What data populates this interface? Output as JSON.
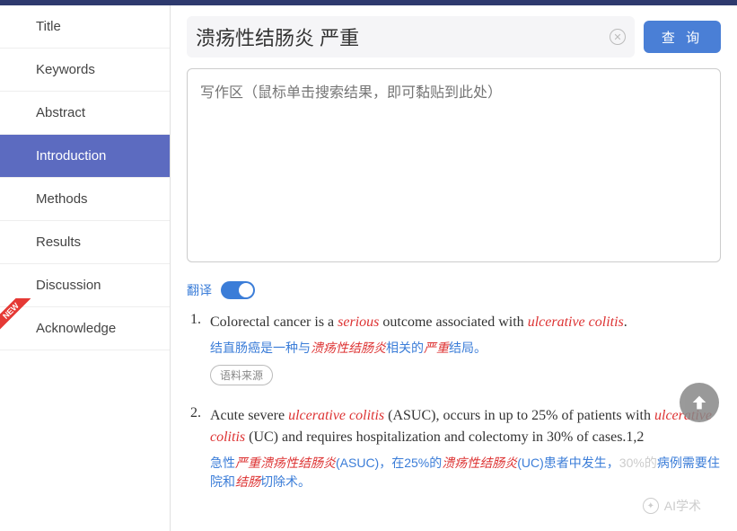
{
  "sidebar": {
    "items": [
      {
        "label": "Title"
      },
      {
        "label": "Keywords"
      },
      {
        "label": "Abstract"
      },
      {
        "label": "Introduction",
        "active": true
      },
      {
        "label": "Methods"
      },
      {
        "label": "Results"
      },
      {
        "label": "Discussion"
      },
      {
        "label": "Acknowledge",
        "new": true
      }
    ],
    "new_badge": "NEW"
  },
  "search": {
    "value": "溃疡性结肠炎 严重",
    "clear_glyph": "✕",
    "query_label": "查 询"
  },
  "writing_area": {
    "placeholder": "写作区（鼠标单击搜索结果，即可黏贴到此处）"
  },
  "translate": {
    "label": "翻译",
    "on": true
  },
  "results": [
    {
      "num": "1.",
      "en_parts": [
        {
          "t": "Colorectal cancer is a ",
          "hl": false
        },
        {
          "t": "serious",
          "hl": true
        },
        {
          "t": " outcome associated with ",
          "hl": false
        },
        {
          "t": "ulcerative colitis",
          "hl": true
        },
        {
          "t": ".",
          "hl": false
        }
      ],
      "zh_parts": [
        {
          "t": "结直肠癌是一种与",
          "hl": false
        },
        {
          "t": "溃疡性结肠炎",
          "hl": true
        },
        {
          "t": "相关的",
          "hl": false
        },
        {
          "t": "严重",
          "hl": true
        },
        {
          "t": "结局。",
          "hl": false
        }
      ],
      "source_label": "语料来源"
    },
    {
      "num": "2.",
      "en_parts": [
        {
          "t": "Acute severe ",
          "hl": false
        },
        {
          "t": "ulcerative colitis",
          "hl": true
        },
        {
          "t": " (ASUC), occurs in up to 25% of patients with ",
          "hl": false
        },
        {
          "t": "ulcerative colitis",
          "hl": true
        },
        {
          "t": " (UC) and requires hospitalization and colectomy in 30% of cases.1,2",
          "hl": false
        }
      ],
      "zh_parts": [
        {
          "t": "急性",
          "hl": false
        },
        {
          "t": "严重溃疡性结肠炎",
          "hl": true
        },
        {
          "t": "(ASUC)，在25%的",
          "hl": false
        },
        {
          "t": "溃疡性结肠炎",
          "hl": true
        },
        {
          "t": "(UC)患者中发生，",
          "hl": false
        },
        {
          "t": "30%的",
          "hl": false,
          "fade": true
        },
        {
          "t": "病例需要住院和",
          "hl": false
        },
        {
          "t": "结肠",
          "hl": true
        },
        {
          "t": "切除术。",
          "hl": false
        }
      ]
    }
  ],
  "watermark": "AI学术"
}
